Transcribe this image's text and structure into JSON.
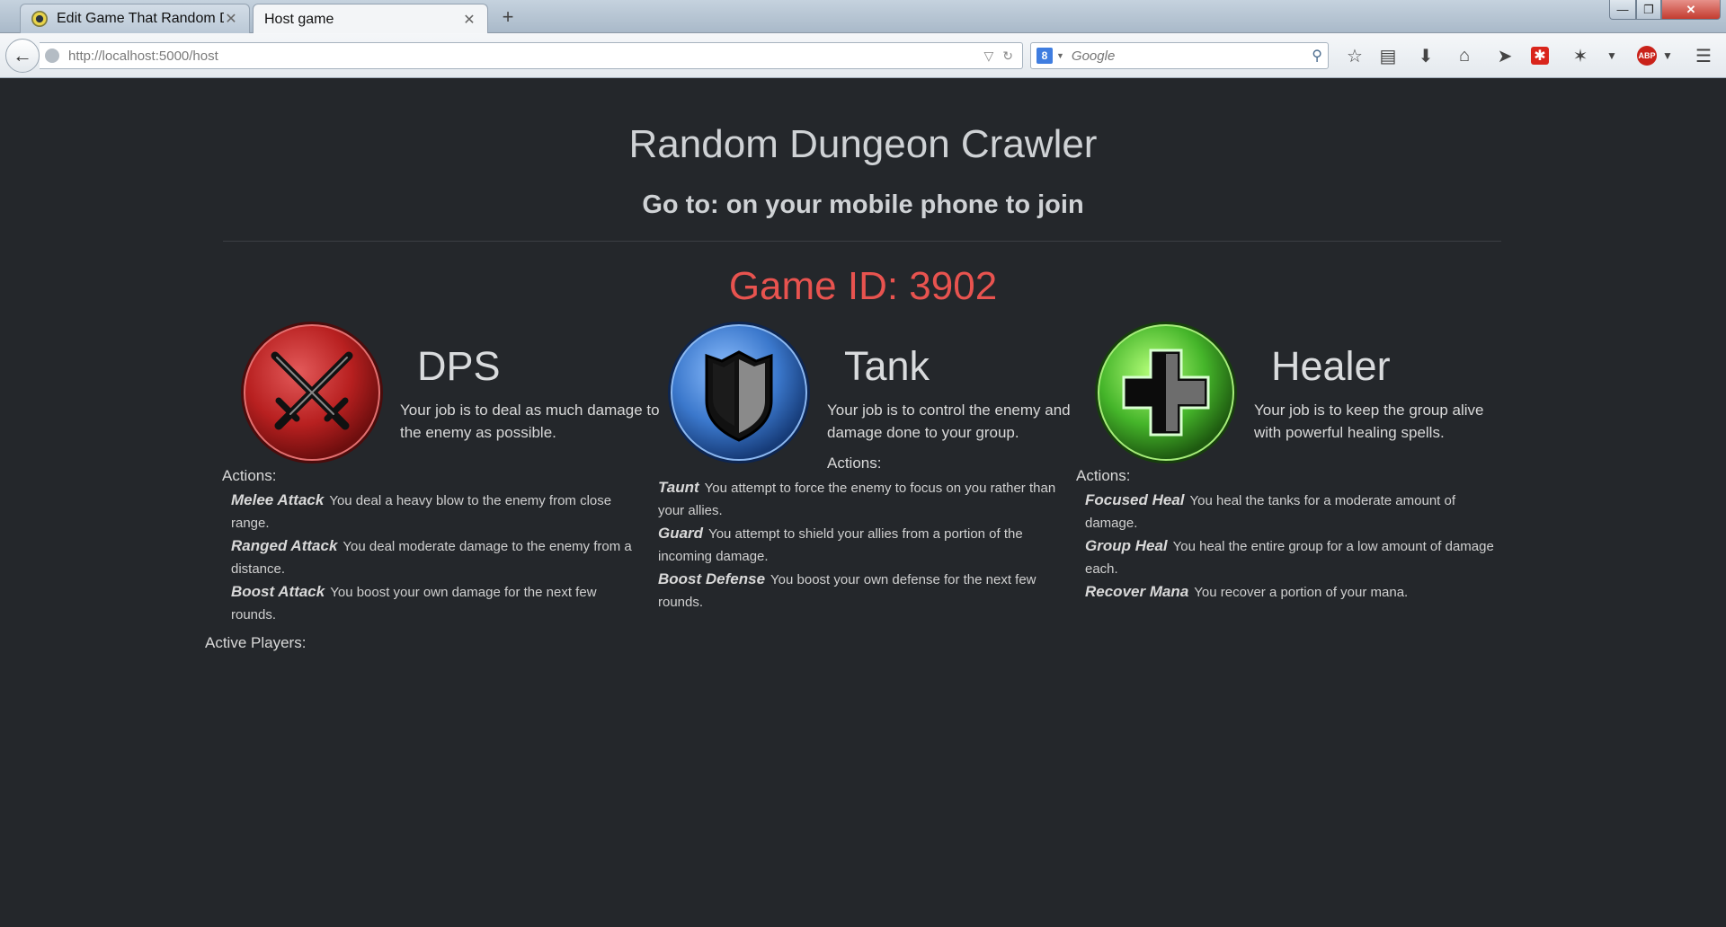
{
  "browser": {
    "tabs": [
      {
        "title": "Edit Game That Random D..."
      },
      {
        "title": "Host game"
      }
    ],
    "new_tab": "+",
    "url": "http://localhost:5000/host",
    "search": {
      "engine": "8",
      "placeholder": "Google"
    },
    "window_controls": {
      "minimize": "—",
      "maximize": "❐",
      "close": "✕"
    }
  },
  "page": {
    "title": "Random Dungeon Crawler",
    "subtitle": "Go to: on your mobile phone to join",
    "game_id": "Game ID: 3902",
    "active_players_label": "Active Players:",
    "roles": [
      {
        "name": "DPS",
        "icon": "crossed-swords-icon",
        "color": "#c62a2a",
        "description": "Your job is to deal as much damage to the enemy as possible.",
        "actions_label": "Actions:",
        "actions": [
          {
            "name": "Melee Attack",
            "text": "You deal a heavy blow to the enemy from close range."
          },
          {
            "name": "Ranged Attack",
            "text": "You deal moderate damage to the enemy from a distance."
          },
          {
            "name": "Boost Attack",
            "text": "You boost your own damage for the next few rounds."
          }
        ]
      },
      {
        "name": "Tank",
        "icon": "shield-icon",
        "color": "#3f7fd0",
        "description": "Your job is to control the enemy and damage done to your group.",
        "actions_label": "Actions:",
        "actions": [
          {
            "name": "Taunt",
            "text": "You attempt to force the enemy to focus on you rather than your allies."
          },
          {
            "name": "Guard",
            "text": "You attempt to shield your allies from a portion of the incoming damage."
          },
          {
            "name": "Boost Defense",
            "text": "You boost your own defense for the next few rounds."
          }
        ]
      },
      {
        "name": "Healer",
        "icon": "healing-cross-icon",
        "color": "#49b52a",
        "description": "Your job is to keep the group alive with powerful healing spells.",
        "actions_label": "Actions:",
        "actions": [
          {
            "name": "Focused Heal",
            "text": "You heal the tanks for a moderate amount of damage."
          },
          {
            "name": "Group Heal",
            "text": "You heal the entire group for a low amount of damage each."
          },
          {
            "name": "Recover Mana",
            "text": "You recover a portion of your mana."
          }
        ]
      }
    ]
  }
}
